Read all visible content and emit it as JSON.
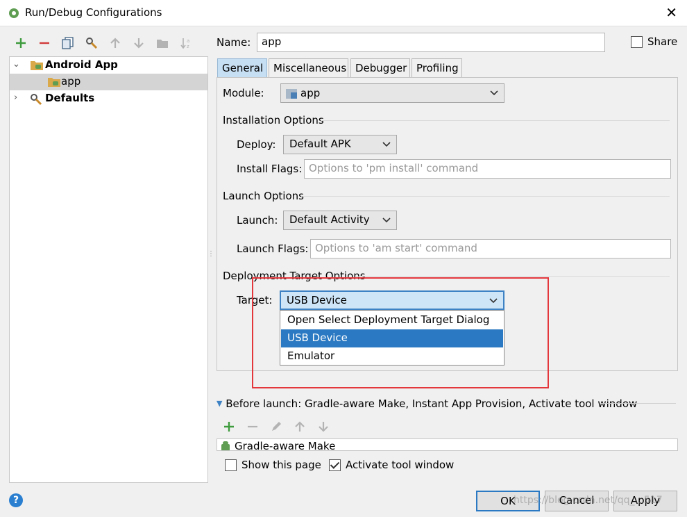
{
  "window": {
    "title": "Run/Debug Configurations",
    "close_glyph": "✕"
  },
  "toolbar": {
    "icons": [
      "add-icon",
      "remove-icon",
      "copy-icon",
      "edit-defaults-icon",
      "move-up-icon",
      "move-down-icon",
      "folder-icon",
      "sort-icon"
    ]
  },
  "tree": {
    "items": [
      {
        "label": "Android App",
        "expanded": true,
        "bold": true
      },
      {
        "label": "app",
        "selected": true
      },
      {
        "label": "Defaults",
        "expanded": false,
        "bold": true
      }
    ]
  },
  "name_field": {
    "label": "Name:",
    "value": "app"
  },
  "share": {
    "label": "Share",
    "checked": false
  },
  "tabs": [
    {
      "label": "General",
      "active": true
    },
    {
      "label": "Miscellaneous"
    },
    {
      "label": "Debugger"
    },
    {
      "label": "Profiling"
    }
  ],
  "general": {
    "module": {
      "label": "Module:",
      "value": "app"
    },
    "installation_header": "Installation Options",
    "deploy": {
      "label": "Deploy:",
      "value": "Default APK"
    },
    "install_flags": {
      "label": "Install Flags:",
      "placeholder": "Options to 'pm install' command"
    },
    "launch_header": "Launch Options",
    "launch": {
      "label": "Launch:",
      "value": "Default Activity"
    },
    "launch_flags": {
      "label": "Launch Flags:",
      "placeholder": "Options to 'am start' command"
    },
    "deployment_header": "Deployment Target Options",
    "target": {
      "label": "Target:",
      "value": "USB Device",
      "options": [
        "Open Select Deployment Target Dialog",
        "USB Device",
        "Emulator"
      ],
      "highlighted": "USB Device"
    }
  },
  "before_launch": {
    "title": "Before launch: Gradle-aware Make, Instant App Provision, Activate tool window",
    "tasks": [
      "Gradle-aware Make"
    ]
  },
  "show_this_page": {
    "label": "Show this page",
    "checked": false
  },
  "activate_tool_window": {
    "label": "Activate tool window",
    "checked": true
  },
  "buttons": {
    "ok": "OK",
    "cancel": "Cancel",
    "apply": "Apply"
  },
  "help_glyph": "?",
  "watermark": "https://blog.csdn.net/qq_...517",
  "colors": {
    "accent": "#2b79c2",
    "highlight_box": "#e3373c",
    "add_green": "#3e9b3e",
    "remove_red": "#d23a3a"
  }
}
